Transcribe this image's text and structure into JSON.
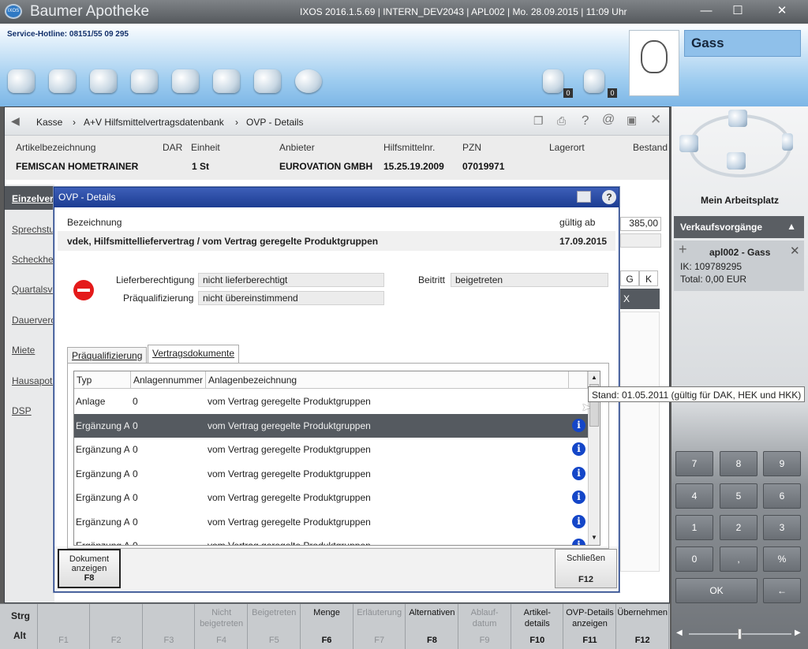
{
  "app": {
    "title": "Baumer Apotheke",
    "logo_text": "IXOS",
    "system_info": "IXOS 2016.1.5.69  |  INTERN_DEV2043  |  APL002  |  Mo. 28.09.2015  |  11:09 Uhr",
    "hotline": "Service-Hotline: 08151/55 09 295",
    "window_buttons": {
      "minimize": "—",
      "restore": "☐",
      "close": "✕"
    }
  },
  "toolbar": {
    "badges": [
      "0",
      "0"
    ]
  },
  "customer": {
    "name": "Gass"
  },
  "right_panel": {
    "workplace_label": "Mein Arbeitsplatz",
    "sales_header": "Verkaufsvorgänge",
    "sales_item": {
      "title": "apl002 - Gass",
      "ik": "IK: 109789295",
      "total": "Total: 0,00 EUR",
      "plus": "+",
      "close": "✕"
    },
    "keypad": [
      "7",
      "8",
      "9",
      "4",
      "5",
      "6",
      "1",
      "2",
      "3",
      "0",
      ",",
      "%"
    ],
    "ok_label": "OK",
    "back_label": "←"
  },
  "breadcrumb": {
    "items": [
      "Kasse",
      "A+V Hilfsmittelvertragsdatenbank",
      "OVP - Details"
    ],
    "separator": "›"
  },
  "article": {
    "labels": [
      "Artikelbezeichnung",
      "DAR",
      "Einheit",
      "Anbieter",
      "Hilfsmittelnr.",
      "PZN",
      "Lagerort",
      "Bestand"
    ],
    "values": {
      "name": "FEMISCAN HOMETRAINER",
      "unit": "1 St",
      "provider": "EUROVATION GMBH",
      "aid_no": "15.25.19.2009",
      "pzn": "07019971"
    }
  },
  "left_tabs": [
    "Einzelverordnung",
    "Sprechstundenbedarf",
    "Scheckheft",
    "Quartalsverordnung",
    "Dauerverordnung",
    "Miete",
    "Hausapotheke",
    "DSP"
  ],
  "background_fragments": {
    "price": "385,00",
    "col_g": "G",
    "col_k": "K",
    "x_mark": "X"
  },
  "modal": {
    "title": "OVP - Details",
    "help": "?",
    "designation_label": "Bezeichnung",
    "valid_from_label": "gültig ab",
    "designation_value": "vdek, Hilfsmittelliefervertrag / vom Vertrag geregelte Produktgruppen",
    "valid_from_value": "17.09.2015",
    "delivery_label": "Lieferberechtigung",
    "delivery_value": "nicht lieferberechtigt",
    "prequal_label": "Präqualifizierung",
    "prequal_value": "nicht übereinstimmend",
    "join_label": "Beitritt",
    "join_value": "beigetreten",
    "tabs": [
      "Präqualifizierung",
      "Vertragsdokumente"
    ],
    "grid": {
      "headers": [
        "Typ",
        "Anlagennummer",
        "Anlagenbezeichnung"
      ],
      "rows": [
        {
          "type": "Anlage",
          "number": "0",
          "name": "vom Vertrag geregelte Produktgruppen",
          "info": false
        },
        {
          "type": "Ergänzung A+V",
          "number": "0",
          "name": "vom Vertrag geregelte Produktgruppen",
          "info": true
        },
        {
          "type": "Ergänzung A+V",
          "number": "0",
          "name": "vom Vertrag geregelte Produktgruppen",
          "info": true
        },
        {
          "type": "Ergänzung A+V",
          "number": "0",
          "name": "vom Vertrag geregelte Produktgruppen",
          "info": true
        },
        {
          "type": "Ergänzung A+V",
          "number": "0",
          "name": "vom Vertrag geregelte Produktgruppen",
          "info": true
        },
        {
          "type": "Ergänzung A+V",
          "number": "0",
          "name": "vom Vertrag geregelte Produktgruppen",
          "info": true
        },
        {
          "type": "Ergänzung A+V",
          "number": "0",
          "name": "vom Vertrag geregelte Produktgruppen",
          "info": true
        }
      ],
      "selected_row": 1
    },
    "tooltip": "Stand: 01.05.2011 (gültig für DAK, HEK und HKK)",
    "btn_show_doc": {
      "label": "Dokument anzeigen",
      "key": "F8"
    },
    "btn_close": {
      "label": "Schließen",
      "key": "F12"
    }
  },
  "fkeys": {
    "modifiers": [
      "Strg",
      "Alt"
    ],
    "keys": [
      {
        "label": "",
        "code": "F1",
        "enabled": false
      },
      {
        "label": "",
        "code": "F2",
        "enabled": false
      },
      {
        "label": "",
        "code": "F3",
        "enabled": false
      },
      {
        "label": "Nicht beigetreten",
        "code": "F4",
        "enabled": false
      },
      {
        "label": "Beigetreten",
        "code": "F5",
        "enabled": false
      },
      {
        "label": "Menge",
        "code": "F6",
        "enabled": true
      },
      {
        "label": "Erläuterung",
        "code": "F7",
        "enabled": false
      },
      {
        "label": "Alternativen",
        "code": "F8",
        "enabled": true
      },
      {
        "label": "Ablauf-datum",
        "code": "F9",
        "enabled": false
      },
      {
        "label": "Artikel-details",
        "code": "F10",
        "enabled": true
      },
      {
        "label": "OVP-Details anzeigen",
        "code": "F11",
        "enabled": true
      },
      {
        "label": "Übernehmen",
        "code": "F12",
        "enabled": true
      }
    ]
  }
}
